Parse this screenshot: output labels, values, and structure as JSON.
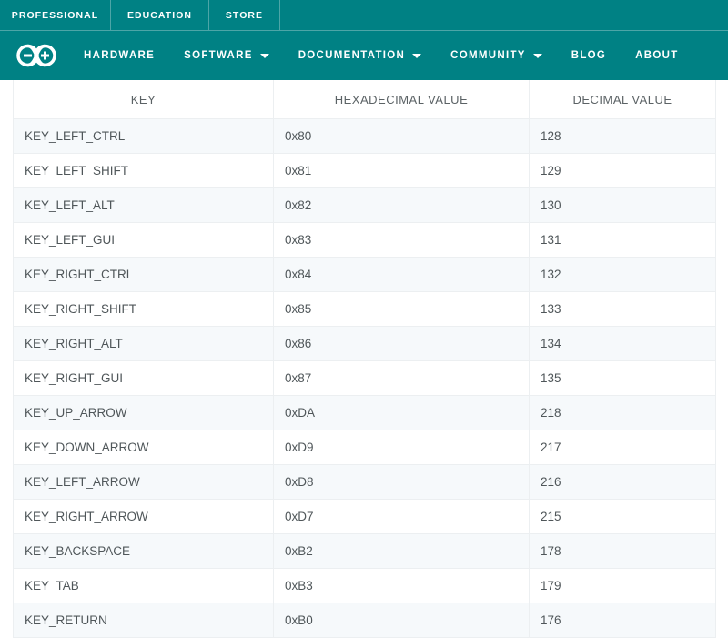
{
  "top_bar": {
    "items": [
      {
        "label": "PROFESSIONAL"
      },
      {
        "label": "EDUCATION"
      },
      {
        "label": "STORE"
      }
    ]
  },
  "main_nav": {
    "logo_name": "arduino-infinity-logo",
    "links": [
      {
        "label": "HARDWARE",
        "has_caret": false
      },
      {
        "label": "SOFTWARE",
        "has_caret": true
      },
      {
        "label": "DOCUMENTATION",
        "has_caret": true
      },
      {
        "label": "COMMUNITY",
        "has_caret": true
      },
      {
        "label": "BLOG",
        "has_caret": false
      },
      {
        "label": "ABOUT",
        "has_caret": false
      }
    ]
  },
  "colors": {
    "brand_teal": "#008184",
    "nav_divider": "#4da5a7",
    "row_stripe": "#f6f9fb",
    "table_border": "#eceff1",
    "text_body": "#4f5659",
    "text_header": "#5b6265"
  },
  "table": {
    "headers": [
      "KEY",
      "HEXADECIMAL VALUE",
      "DECIMAL VALUE"
    ],
    "rows": [
      {
        "key": "KEY_LEFT_CTRL",
        "hex": "0x80",
        "dec": "128"
      },
      {
        "key": "KEY_LEFT_SHIFT",
        "hex": "0x81",
        "dec": "129"
      },
      {
        "key": "KEY_LEFT_ALT",
        "hex": "0x82",
        "dec": "130"
      },
      {
        "key": "KEY_LEFT_GUI",
        "hex": "0x83",
        "dec": "131"
      },
      {
        "key": "KEY_RIGHT_CTRL",
        "hex": "0x84",
        "dec": "132"
      },
      {
        "key": "KEY_RIGHT_SHIFT",
        "hex": "0x85",
        "dec": "133"
      },
      {
        "key": "KEY_RIGHT_ALT",
        "hex": "0x86",
        "dec": "134"
      },
      {
        "key": "KEY_RIGHT_GUI",
        "hex": "0x87",
        "dec": "135"
      },
      {
        "key": "KEY_UP_ARROW",
        "hex": "0xDA",
        "dec": "218"
      },
      {
        "key": "KEY_DOWN_ARROW",
        "hex": "0xD9",
        "dec": "217"
      },
      {
        "key": "KEY_LEFT_ARROW",
        "hex": "0xD8",
        "dec": "216"
      },
      {
        "key": "KEY_RIGHT_ARROW",
        "hex": "0xD7",
        "dec": "215"
      },
      {
        "key": "KEY_BACKSPACE",
        "hex": "0xB2",
        "dec": "178"
      },
      {
        "key": "KEY_TAB",
        "hex": "0xB3",
        "dec": "179"
      },
      {
        "key": "KEY_RETURN",
        "hex": "0xB0",
        "dec": "176"
      }
    ]
  }
}
